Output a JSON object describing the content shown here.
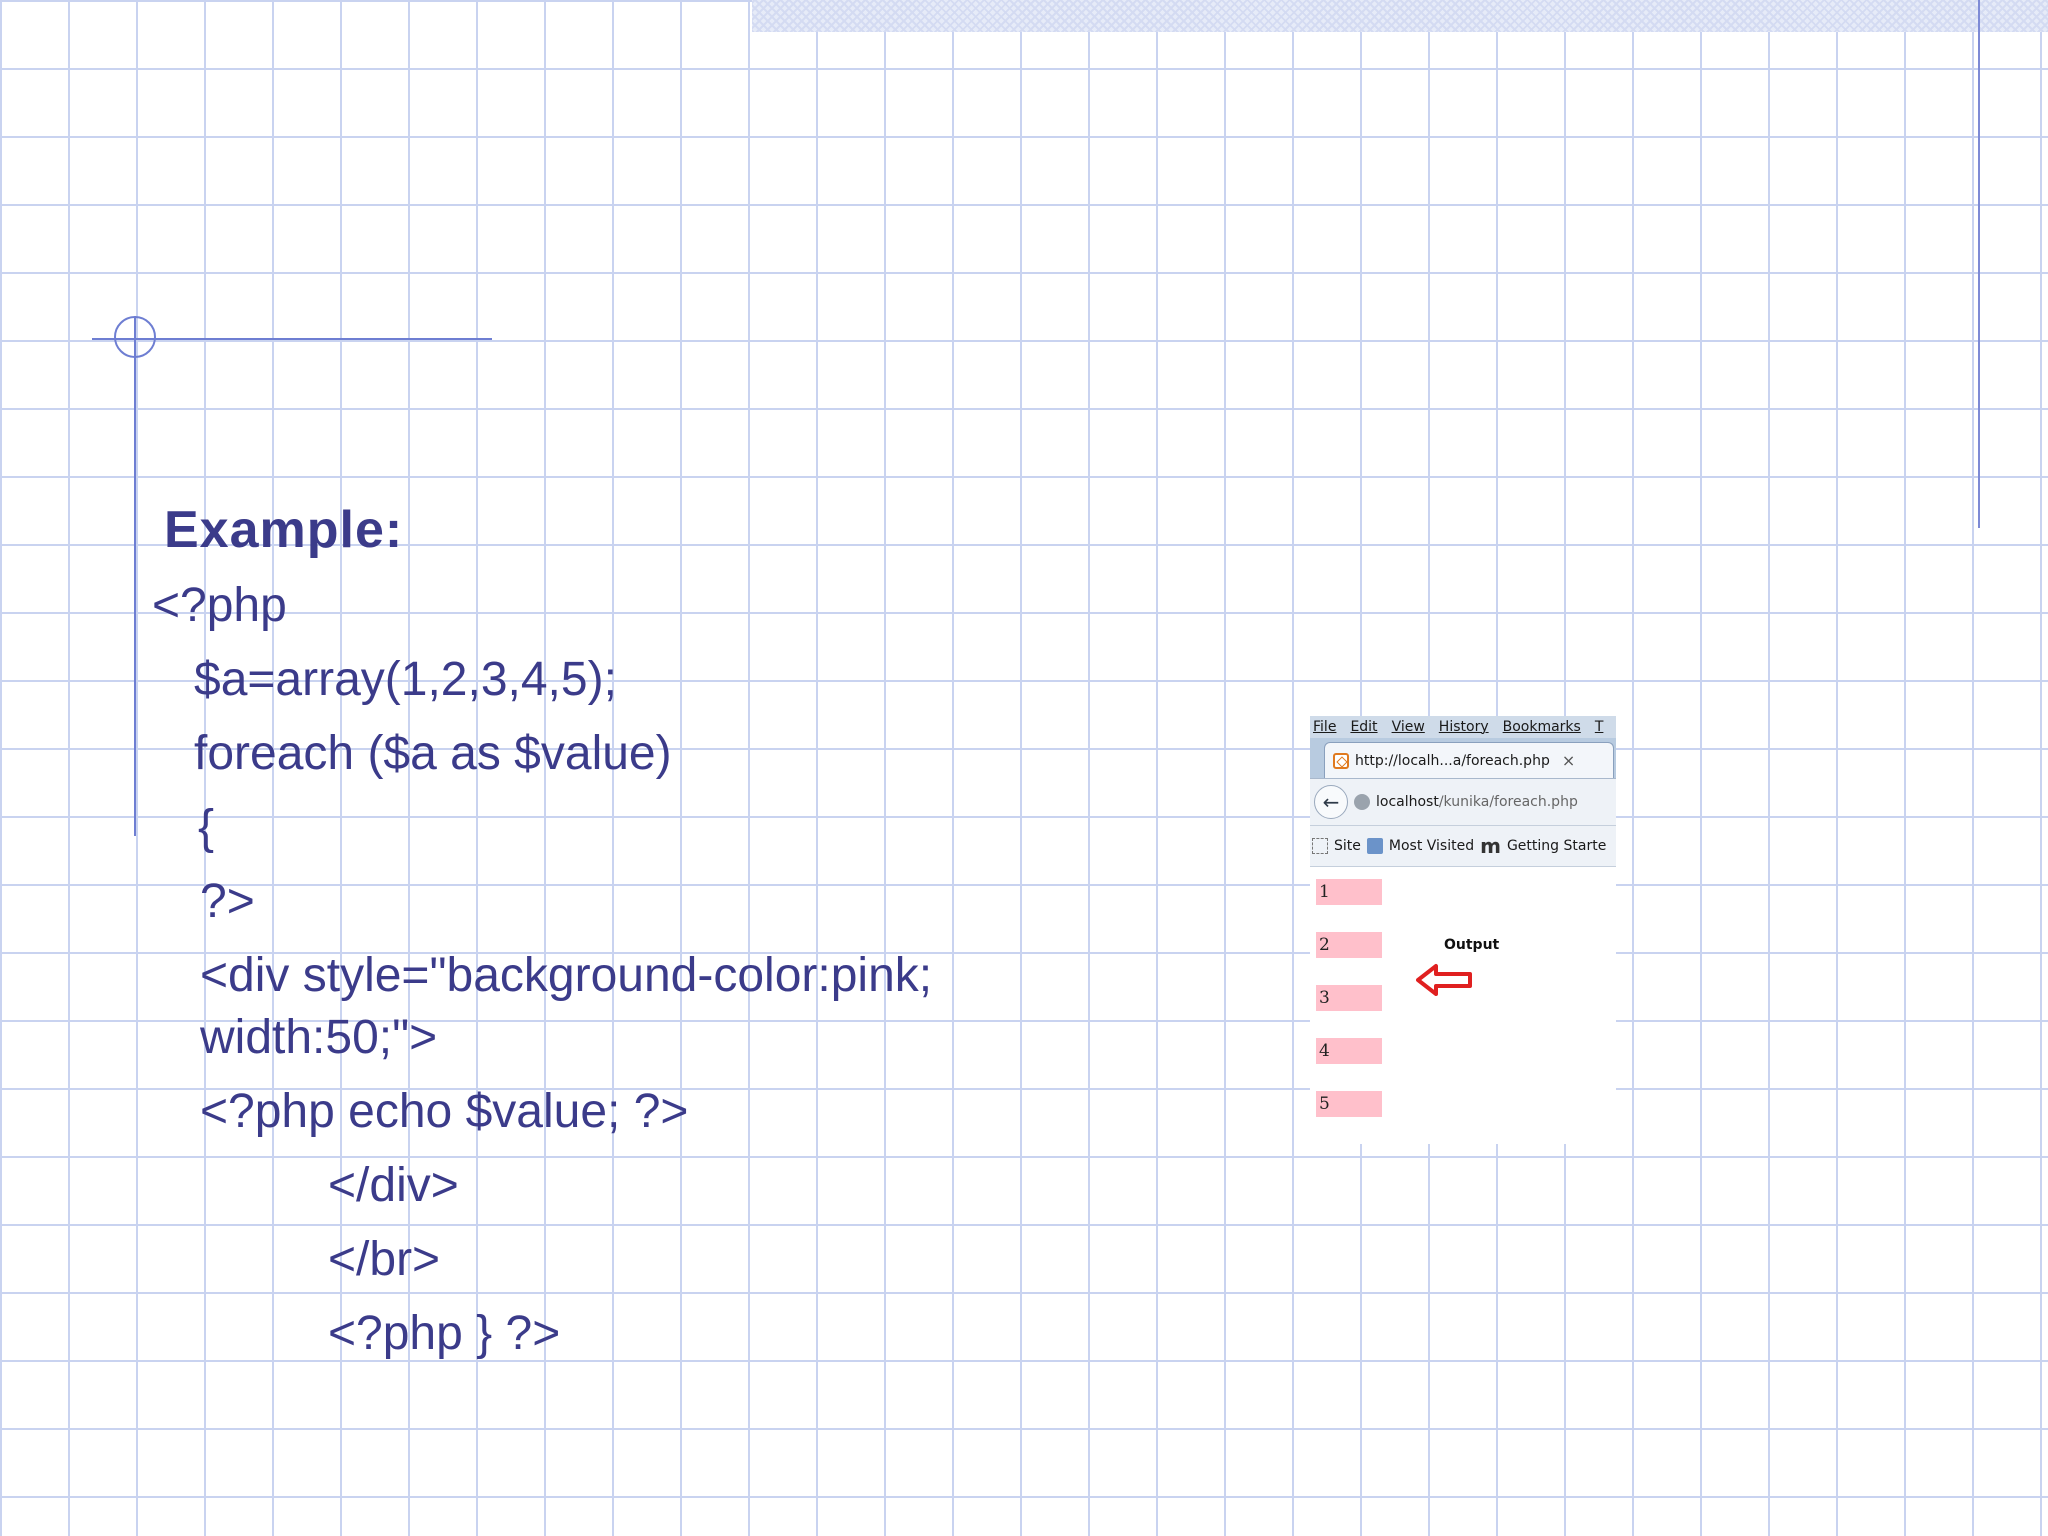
{
  "slide": {
    "heading": "Example:",
    "code_lines": [
      "<?php",
      "$a=array(1,2,3,4,5);",
      "foreach ($a as $value)",
      "{",
      "?>",
      "<div style=\"background-color:pink;",
      "width:50;\">",
      "<?php echo $value; ?>",
      "</div>",
      "</br>",
      "<?php } ?>"
    ]
  },
  "browser": {
    "menu": [
      "File",
      "Edit",
      "View",
      "History",
      "Bookmarks",
      "T"
    ],
    "tab_title": "http://localh...a/foreach.php",
    "tab_close": "×",
    "url_host": "localhost",
    "url_path": "/kunika/foreach.php",
    "bookmarks": [
      "Site",
      "Most Visited",
      "Getting Starte"
    ],
    "bookmark_m": "m",
    "output_values": [
      "1",
      "2",
      "3",
      "4",
      "5"
    ],
    "output_label": "Output"
  },
  "colors": {
    "text": "#3b3b8a",
    "grid": "#c9d3f0",
    "pink": "#ffc0cb",
    "arrow": "#e02020"
  }
}
